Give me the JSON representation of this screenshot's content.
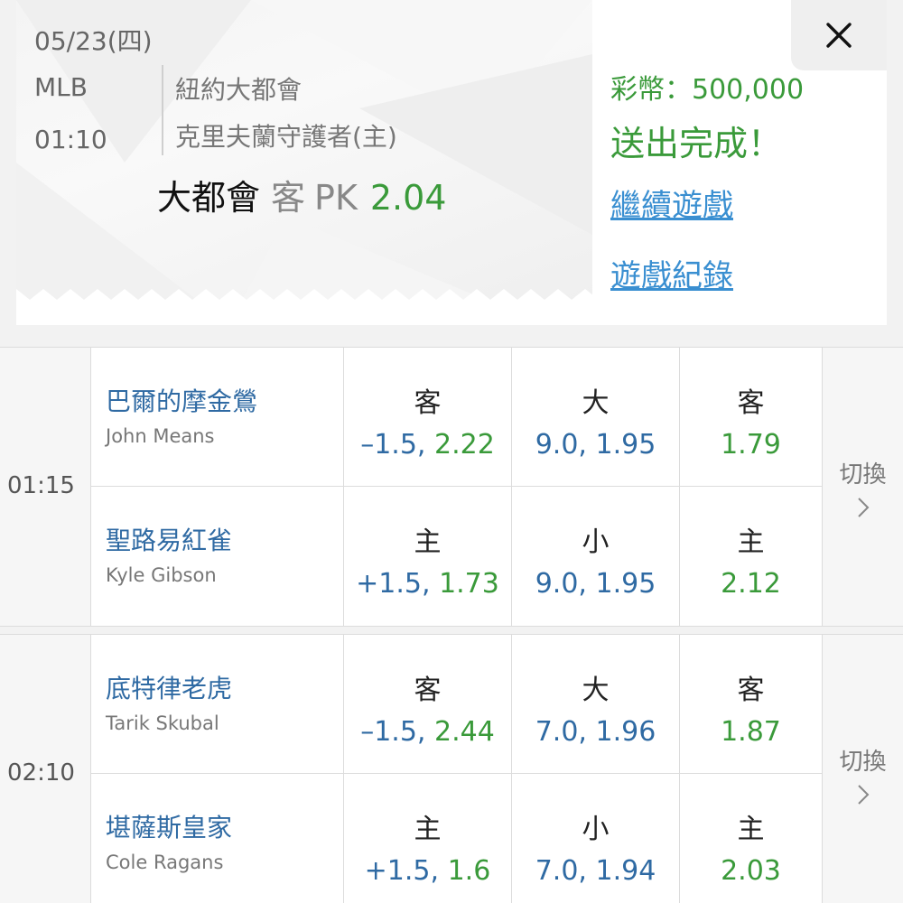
{
  "ticket": {
    "date": "05/23(四)",
    "league": "MLB",
    "time": "01:10",
    "away_team": "紐約大都會",
    "home_team": "克里夫蘭守護者(主)",
    "bet_pick": "大都會",
    "bet_side": "客",
    "bet_type": "PK",
    "bet_odds": "2.04",
    "coins_text": "彩幣：500,000",
    "status_text": "送出完成！",
    "continue_link": "繼續遊戲",
    "history_link": "遊戲紀錄",
    "close_icon": "close-icon"
  },
  "games": [
    {
      "time": "01:15",
      "switch_label": "切換",
      "teams": [
        {
          "name": "巴爾的摩金鶯",
          "pitcher": "John Means",
          "spread_head": "客",
          "spread_line": "–1.5, ",
          "spread_odds": "2.22",
          "total_head": "大",
          "total_val": "9.0, 1.95",
          "ml_head": "客",
          "ml_odds": "1.79"
        },
        {
          "name": "聖路易紅雀",
          "pitcher": "Kyle Gibson",
          "spread_head": "主",
          "spread_line": "+1.5, ",
          "spread_odds": "1.73",
          "total_head": "小",
          "total_val": "9.0, 1.95",
          "ml_head": "主",
          "ml_odds": "2.12"
        }
      ]
    },
    {
      "time": "02:10",
      "switch_label": "切換",
      "teams": [
        {
          "name": "底特律老虎",
          "pitcher": "Tarik Skubal",
          "spread_head": "客",
          "spread_line": "–1.5, ",
          "spread_odds": "2.44",
          "total_head": "大",
          "total_val": "7.0, 1.96",
          "ml_head": "客",
          "ml_odds": "1.87"
        },
        {
          "name": "堪薩斯皇家",
          "pitcher": "Cole Ragans",
          "spread_head": "主",
          "spread_line": "+1.5, ",
          "spread_odds": "1.6",
          "total_head": "小",
          "total_val": "7.0, 1.94",
          "ml_head": "主",
          "ml_odds": "2.03"
        }
      ]
    }
  ],
  "colors": {
    "green": "#3a9a3a",
    "blue": "#2f6aa3",
    "link": "#3a8fd1"
  }
}
